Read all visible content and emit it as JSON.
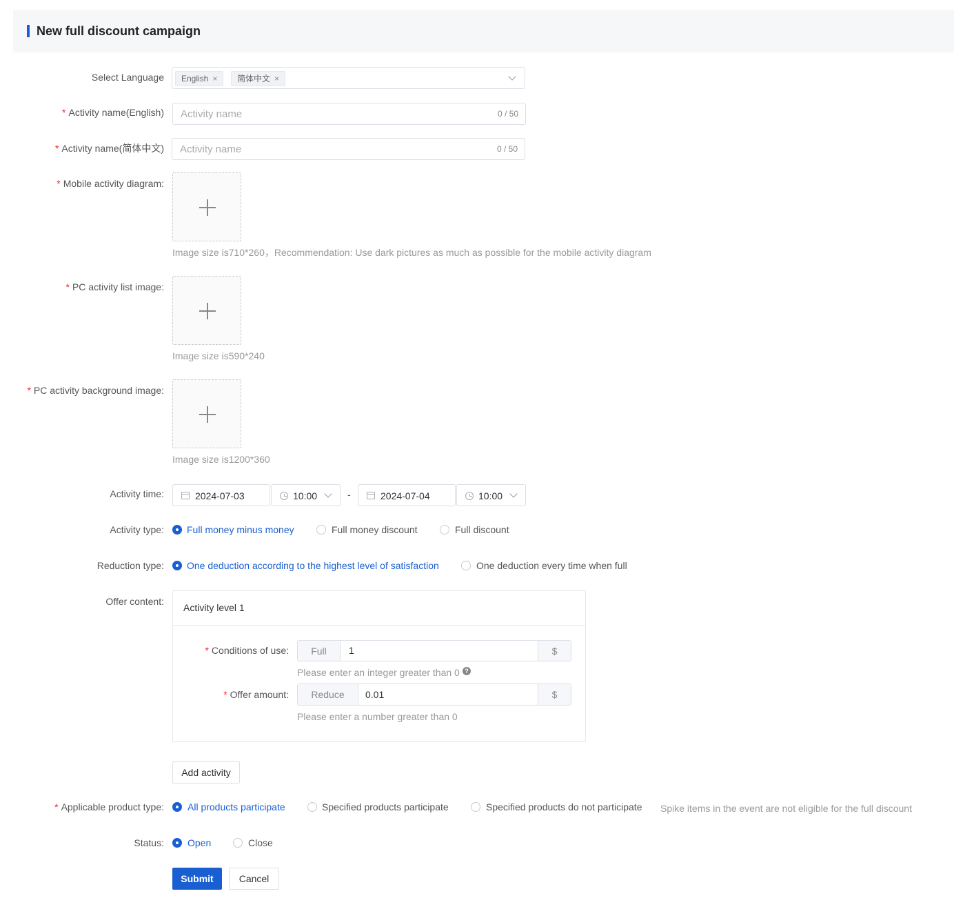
{
  "header": {
    "title": "New full discount campaign"
  },
  "language": {
    "label": "Select Language",
    "tags": [
      {
        "label": "English"
      },
      {
        "label": "简体中文"
      }
    ],
    "remove_glyph": "×"
  },
  "name_en": {
    "label": "Activity name(English)",
    "placeholder": "Activity name",
    "count": "0 / 50"
  },
  "name_zh": {
    "label": "Activity name(简体中文)",
    "placeholder": "Activity name",
    "count": "0 / 50"
  },
  "mobile_diagram": {
    "label": "Mobile activity diagram:",
    "hint": "Image size is710*260，Recommendation: Use dark pictures as much as possible for the mobile activity diagram"
  },
  "pc_list_image": {
    "label": "PC activity list image:",
    "hint": "Image size is590*240"
  },
  "pc_bg_image": {
    "label": "PC activity background image:",
    "hint": "Image size is1200*360"
  },
  "activity_time": {
    "label": "Activity time:",
    "start_date": "2024-07-03",
    "start_time": "10:00",
    "separator": "-",
    "end_date": "2024-07-04",
    "end_time": "10:00"
  },
  "activity_type": {
    "label": "Activity type:",
    "options": [
      "Full money minus money",
      "Full money discount",
      "Full discount"
    ],
    "selected": "Full money minus money"
  },
  "reduction_type": {
    "label": "Reduction type:",
    "options": [
      "One deduction according to the highest level of satisfaction",
      "One deduction every time when full"
    ],
    "selected": "One deduction according to the highest level of satisfaction"
  },
  "offer": {
    "label": "Offer content:",
    "level_title": "Activity level 1",
    "conditions": {
      "label": "Conditions of use:",
      "prefix": "Full",
      "value": "1",
      "suffix": "$",
      "hint": "Please enter an integer greater than 0",
      "help_glyph": "?"
    },
    "amount": {
      "label": "Offer amount:",
      "prefix": "Reduce",
      "value": "0.01",
      "suffix": "$",
      "hint": "Please enter a number greater than 0"
    }
  },
  "add_activity_label": "Add activity",
  "product_type": {
    "label": "Applicable product type:",
    "options": [
      "All products participate",
      "Specified products participate",
      "Specified products do not participate"
    ],
    "selected": "All products participate",
    "note": "Spike items in the event are not eligible for the full discount"
  },
  "status": {
    "label": "Status:",
    "options": [
      "Open",
      "Close"
    ],
    "selected": "Open"
  },
  "actions": {
    "submit": "Submit",
    "cancel": "Cancel"
  },
  "colors": {
    "accent": "#1a5fd1",
    "required": "#f5222d",
    "header_bg": "#f6f7f9"
  }
}
